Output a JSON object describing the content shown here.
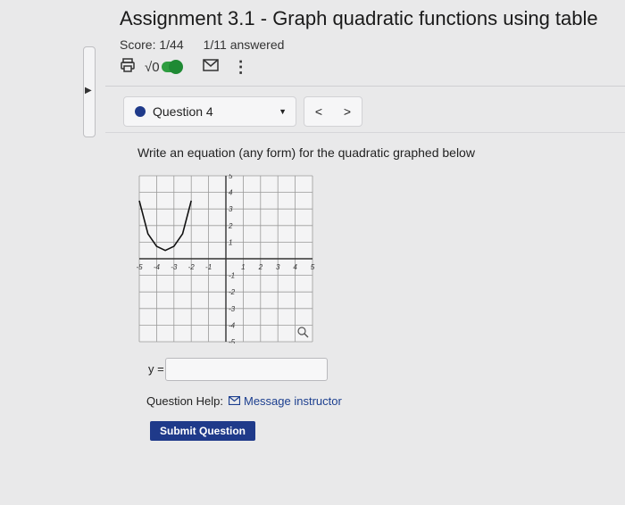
{
  "header": {
    "title": "Assignment 3.1 - Graph quadratic functions using table",
    "score": "Score: 1/44",
    "answered": "1/11 answered"
  },
  "toolbar": {
    "print_icon": "printer-icon",
    "math_symbol": "√0",
    "toggle_state": "on",
    "mail_icon": "envelope-icon",
    "more_icon": "⋮"
  },
  "question": {
    "selector_label": "Question 4",
    "prev": "<",
    "next": ">",
    "prompt": "Write an equation (any form) for the quadratic graphed below",
    "answer_label": "y =",
    "answer_value": "",
    "help_label": "Question Help:",
    "message_label": "Message instructor",
    "submit_label": "Submit Question"
  },
  "graph": {
    "x_ticks": [
      "-5",
      "-4",
      "-3",
      "-2",
      "-1",
      "1",
      "2",
      "3",
      "4",
      "5"
    ],
    "y_ticks": [
      "5",
      "4",
      "3",
      "2",
      "1",
      "-1",
      "-2",
      "-3",
      "-4",
      "-5"
    ],
    "x_range": [
      -5,
      5
    ],
    "y_range": [
      -5,
      5
    ],
    "vertex": [
      -3.5,
      0.5
    ],
    "parabola_points": [
      [
        -5,
        3.5
      ],
      [
        -4.5,
        1.5
      ],
      [
        -4,
        0.75
      ],
      [
        -3.5,
        0.5
      ],
      [
        -3,
        0.75
      ],
      [
        -2.5,
        1.5
      ],
      [
        -2,
        3.5
      ]
    ],
    "curve_color": "#111111",
    "grid_color": "#9a9a9a"
  },
  "colors": {
    "accent": "#1f3a8a",
    "toggle": "#2e9d40"
  }
}
